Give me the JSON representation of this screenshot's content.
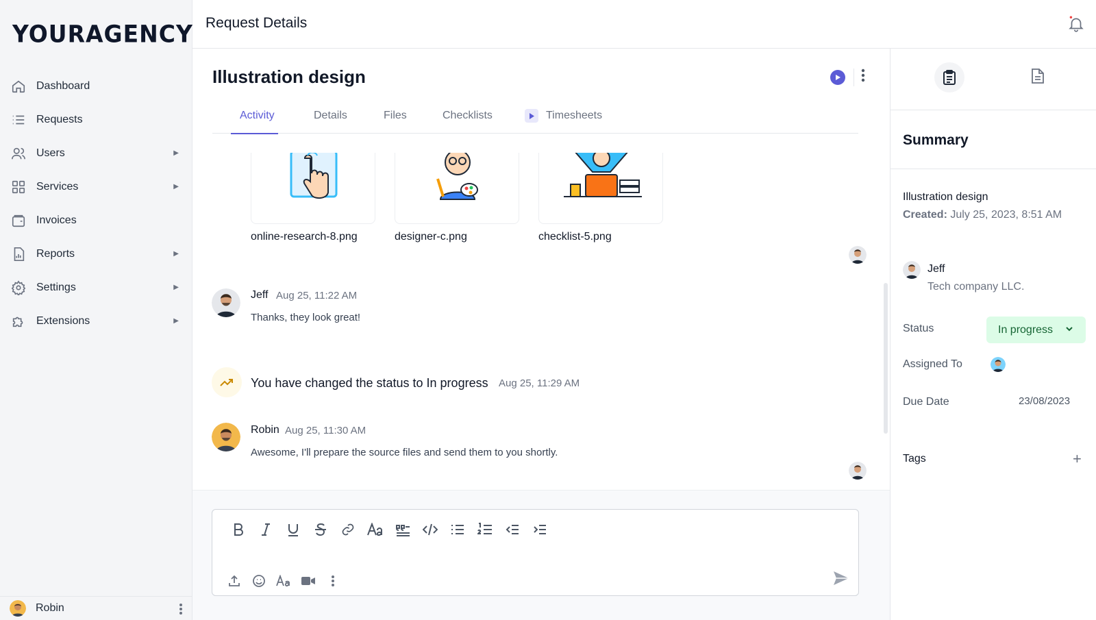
{
  "brand": {
    "logo_text": "YOURAGENCY"
  },
  "sidebar": {
    "items": [
      {
        "label": "Dashboard",
        "icon": "home-icon",
        "has_submenu": false
      },
      {
        "label": "Requests",
        "icon": "list-icon",
        "has_submenu": false
      },
      {
        "label": "Users",
        "icon": "users-icon",
        "has_submenu": true
      },
      {
        "label": "Services",
        "icon": "grid-icon",
        "has_submenu": true
      },
      {
        "label": "Invoices",
        "icon": "wallet-icon",
        "has_submenu": false
      },
      {
        "label": "Reports",
        "icon": "report-icon",
        "has_submenu": true
      },
      {
        "label": "Settings",
        "icon": "gear-icon",
        "has_submenu": true
      },
      {
        "label": "Extensions",
        "icon": "puzzle-icon",
        "has_submenu": true
      }
    ],
    "user": {
      "name": "Robin"
    }
  },
  "header": {
    "title": "Request Details"
  },
  "request": {
    "title": "Illustration design",
    "tabs": [
      "Activity",
      "Details",
      "Files",
      "Checklists",
      "Timesheets"
    ],
    "active_tab": "Activity"
  },
  "activity": {
    "files": [
      {
        "name": "online-research-8.png"
      },
      {
        "name": "designer-c.png"
      },
      {
        "name": "checklist-5.png"
      }
    ],
    "messages": [
      {
        "author": "Jeff",
        "time": "Aug 25, 11:22 AM",
        "text": "Thanks, they look great!"
      },
      {
        "author": "Robin",
        "time": "Aug 25, 11:30 AM",
        "text": "Awesome, I'll prepare the source files and send them to you shortly."
      }
    ],
    "status_change": {
      "text": "You have changed the status to In progress",
      "time": "Aug 25, 11:29 AM"
    }
  },
  "summary": {
    "heading": "Summary",
    "request_name": "Illustration design",
    "created_label": "Created:",
    "created_value": "July 25, 2023, 8:51 AM",
    "client_name": "Jeff",
    "client_company": "Tech company LLC.",
    "status_label": "Status",
    "status_value": "In progress",
    "assigned_label": "Assigned To",
    "due_label": "Due Date",
    "due_value": "23/08/2023",
    "tags_label": "Tags"
  },
  "colors": {
    "accent": "#5b5bd6",
    "status_bg": "#dcfce7",
    "status_fg": "#166534"
  }
}
